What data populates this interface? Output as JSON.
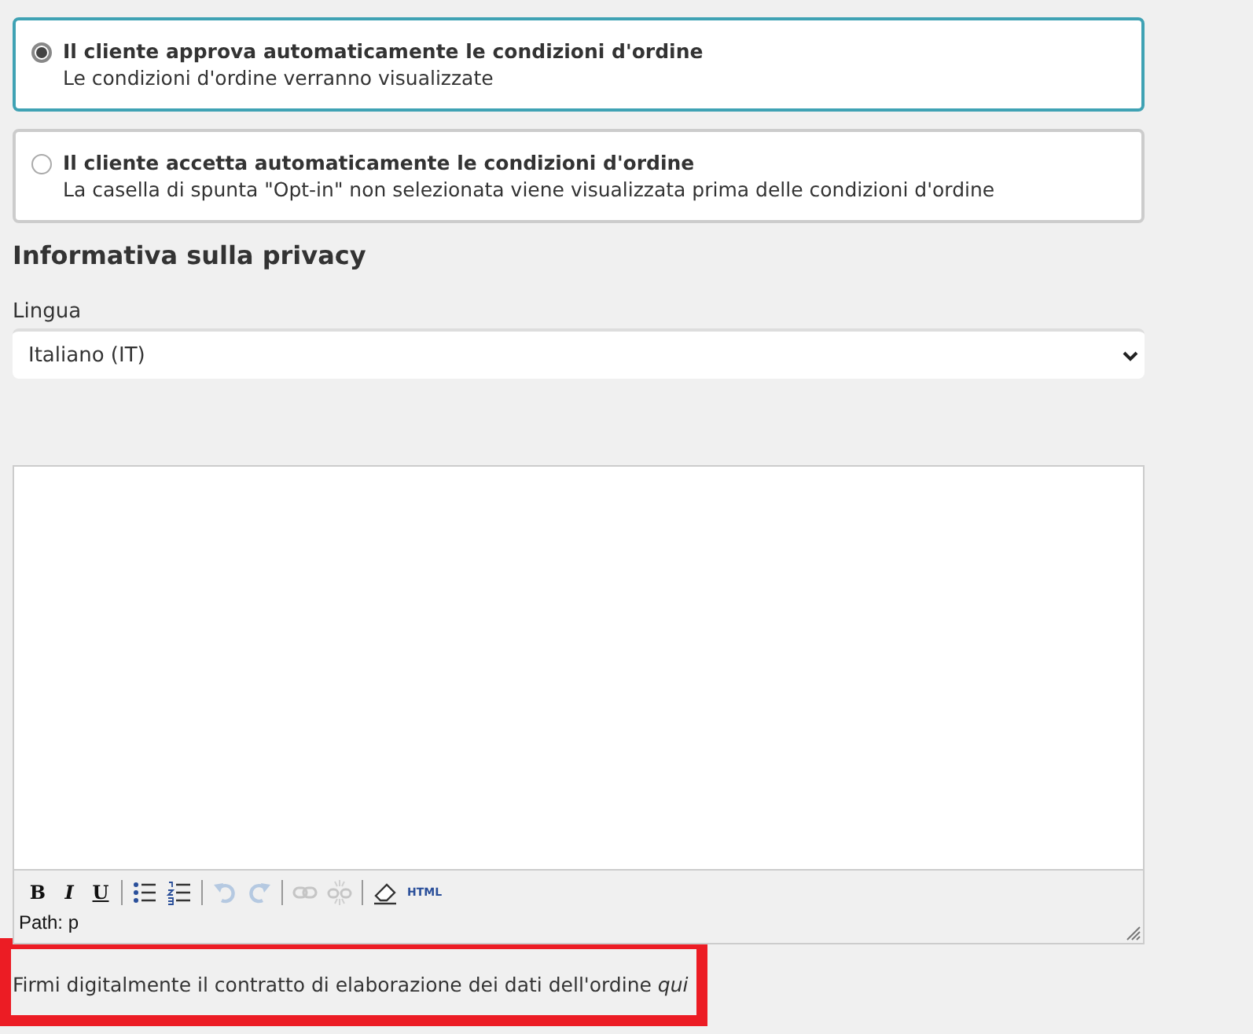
{
  "options": [
    {
      "title": "Il cliente approva automaticamente le condizioni d'ordine",
      "description": "Le condizioni d'ordine verranno visualizzate",
      "selected": true
    },
    {
      "title": "Il cliente accetta automaticamente le condizioni d'ordine",
      "description": "La casella di spunta \"Opt-in\" non selezionata viene visualizzata prima delle condizioni d'ordine",
      "selected": false
    }
  ],
  "privacy": {
    "heading": "Informativa sulla privacy",
    "language_label": "Lingua",
    "language_value": "Italiano (IT)"
  },
  "editor": {
    "toolbar": [
      [
        {
          "kind": "bold",
          "label": "B",
          "disabled": false
        },
        {
          "kind": "italic",
          "label": "I",
          "disabled": false
        },
        {
          "kind": "underline",
          "label": "U",
          "disabled": false
        }
      ],
      [
        {
          "kind": "bullets",
          "disabled": false
        },
        {
          "kind": "numbers",
          "disabled": false
        }
      ],
      [
        {
          "kind": "undo",
          "disabled": true
        },
        {
          "kind": "redo",
          "disabled": true
        }
      ],
      [
        {
          "kind": "link",
          "disabled": true
        },
        {
          "kind": "unlink",
          "disabled": true
        }
      ],
      [
        {
          "kind": "eraser",
          "disabled": false
        },
        {
          "kind": "html",
          "label": "HTML",
          "disabled": false
        }
      ]
    ],
    "path": "Path: p"
  },
  "notice": {
    "text": "Firmi digitalmente il contratto di elaborazione dei dati dell'ordine",
    "link": "qui"
  }
}
